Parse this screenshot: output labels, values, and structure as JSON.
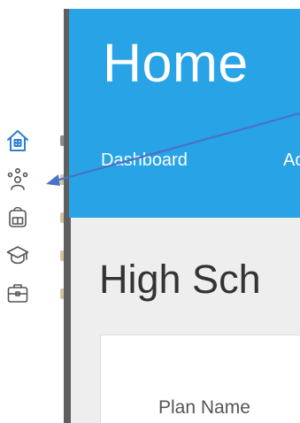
{
  "header": {
    "title": "Home",
    "color": "#27a3e6"
  },
  "nav": {
    "items": [
      {
        "label": "Dashboard"
      },
      {
        "label": "Ac"
      }
    ],
    "active_index": 0
  },
  "main": {
    "section_title": "High Sch",
    "table": {
      "column_header": "Plan Name"
    }
  },
  "sidebar": {
    "icons": [
      {
        "name": "home-icon",
        "color": "#2b7fd6",
        "active": true
      },
      {
        "name": "team-icon",
        "color": "#555555",
        "active": false
      },
      {
        "name": "school-bag-icon",
        "color": "#555555",
        "active": false
      },
      {
        "name": "graduation-cap-icon",
        "color": "#555555",
        "active": false
      },
      {
        "name": "briefcase-icon",
        "color": "#555555",
        "active": false
      }
    ]
  },
  "annotation": {
    "color": "#4a72c4"
  }
}
